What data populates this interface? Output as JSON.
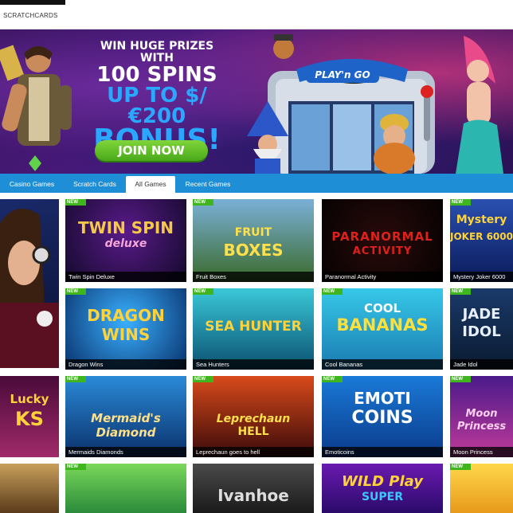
{
  "topbar": {
    "breadcrumb": "SCRATCHCARDS"
  },
  "banner": {
    "line1": "WIN HUGE PRIZES WITH",
    "line2": "100 SPINS",
    "line3": "UP TO $/€200",
    "line4": "BONUS!",
    "join_label": "JOIN NOW",
    "brand": "PLAY'n GO"
  },
  "tabs": [
    {
      "label": "Casino Games"
    },
    {
      "label": "Scratch Cards"
    },
    {
      "label": "All Games",
      "active": true
    },
    {
      "label": "Recent Games"
    }
  ],
  "badge_label": "NEW",
  "games": [
    {
      "title": "Twin Spin Deluxe",
      "logo": "TWIN SPIN",
      "logo2": "deluxe"
    },
    {
      "title": "Fruit Boxes",
      "logo": "FRUIT",
      "logo2": "BOXES"
    },
    {
      "title": "Paranormal Activity",
      "logo": "PARANORMAL",
      "logo2": "ACTIVITY"
    },
    {
      "title": "Mystery Joker 6000",
      "logo": "Mystery",
      "logo2": "JOKER 6000"
    },
    {
      "title": "Dragon Wins",
      "logo": "DRAGON",
      "logo2": "WINS"
    },
    {
      "title": "Sea Hunters",
      "logo": "SEA HUNTER",
      "logo2": ""
    },
    {
      "title": "Cool Bananas",
      "logo": "COOL",
      "logo2": "BANANAS"
    },
    {
      "title": "Jade Idol",
      "logo": "JADE",
      "logo2": "IDOL"
    },
    {
      "title": "Mermaids Diamonds",
      "logo": "Mermaid's",
      "logo2": "Diamond"
    },
    {
      "title": "Leprechaun goes to hell",
      "logo": "Leprechaun",
      "logo2": "HELL"
    },
    {
      "title": "Emoticoins",
      "logo": "EMOTI",
      "logo2": "COINS"
    },
    {
      "title": "Moon Princess",
      "logo": "Moon",
      "logo2": "Princess"
    },
    {
      "title": "",
      "logo": "Lucky",
      "logo2": "KS"
    },
    {
      "title": "",
      "logo": "Ivanhoe",
      "logo2": ""
    },
    {
      "title": "",
      "logo": "WILD Play",
      "logo2": "SUPER"
    }
  ],
  "colors": {
    "tabbar": "#1e8fd6",
    "badge": "#3fb51e",
    "join": "#5cbe22",
    "accent_blue": "#2aa8ff"
  }
}
